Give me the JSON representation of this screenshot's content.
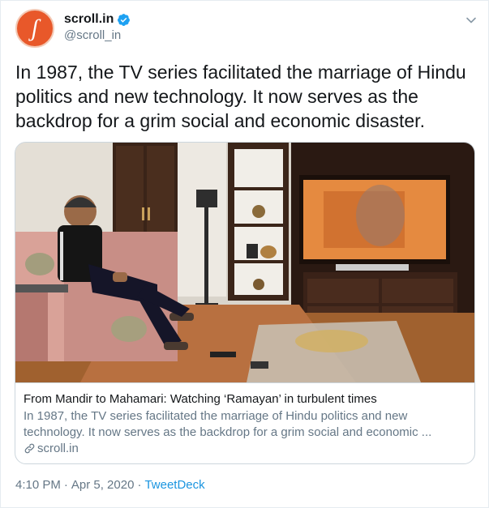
{
  "author": {
    "display_name": "scroll.in",
    "handle": "@scroll_in",
    "avatar_letter": "ʃ",
    "avatar_color": "#e8582a",
    "verified": true
  },
  "tweet_text": "In 1987, the TV series facilitated the marriage of Hindu politics and new technology. It now serves as the backdrop for a grim social and economic disaster.",
  "card": {
    "title": "From Mandir to Mahamari: Watching ‘Ramayan’ in turbulent times",
    "description": "In 1987, the TV series facilitated the marriage of Hindu politics and new technology. It now serves as the backdrop for a grim social and economic ...",
    "domain": "scroll.in"
  },
  "meta": {
    "time": "4:10 PM",
    "date": "Apr 5, 2020",
    "separator": "·",
    "source": "TweetDeck"
  },
  "colors": {
    "link": "#1b95e0",
    "secondary_text": "#657786",
    "border": "#ccd6dd"
  }
}
